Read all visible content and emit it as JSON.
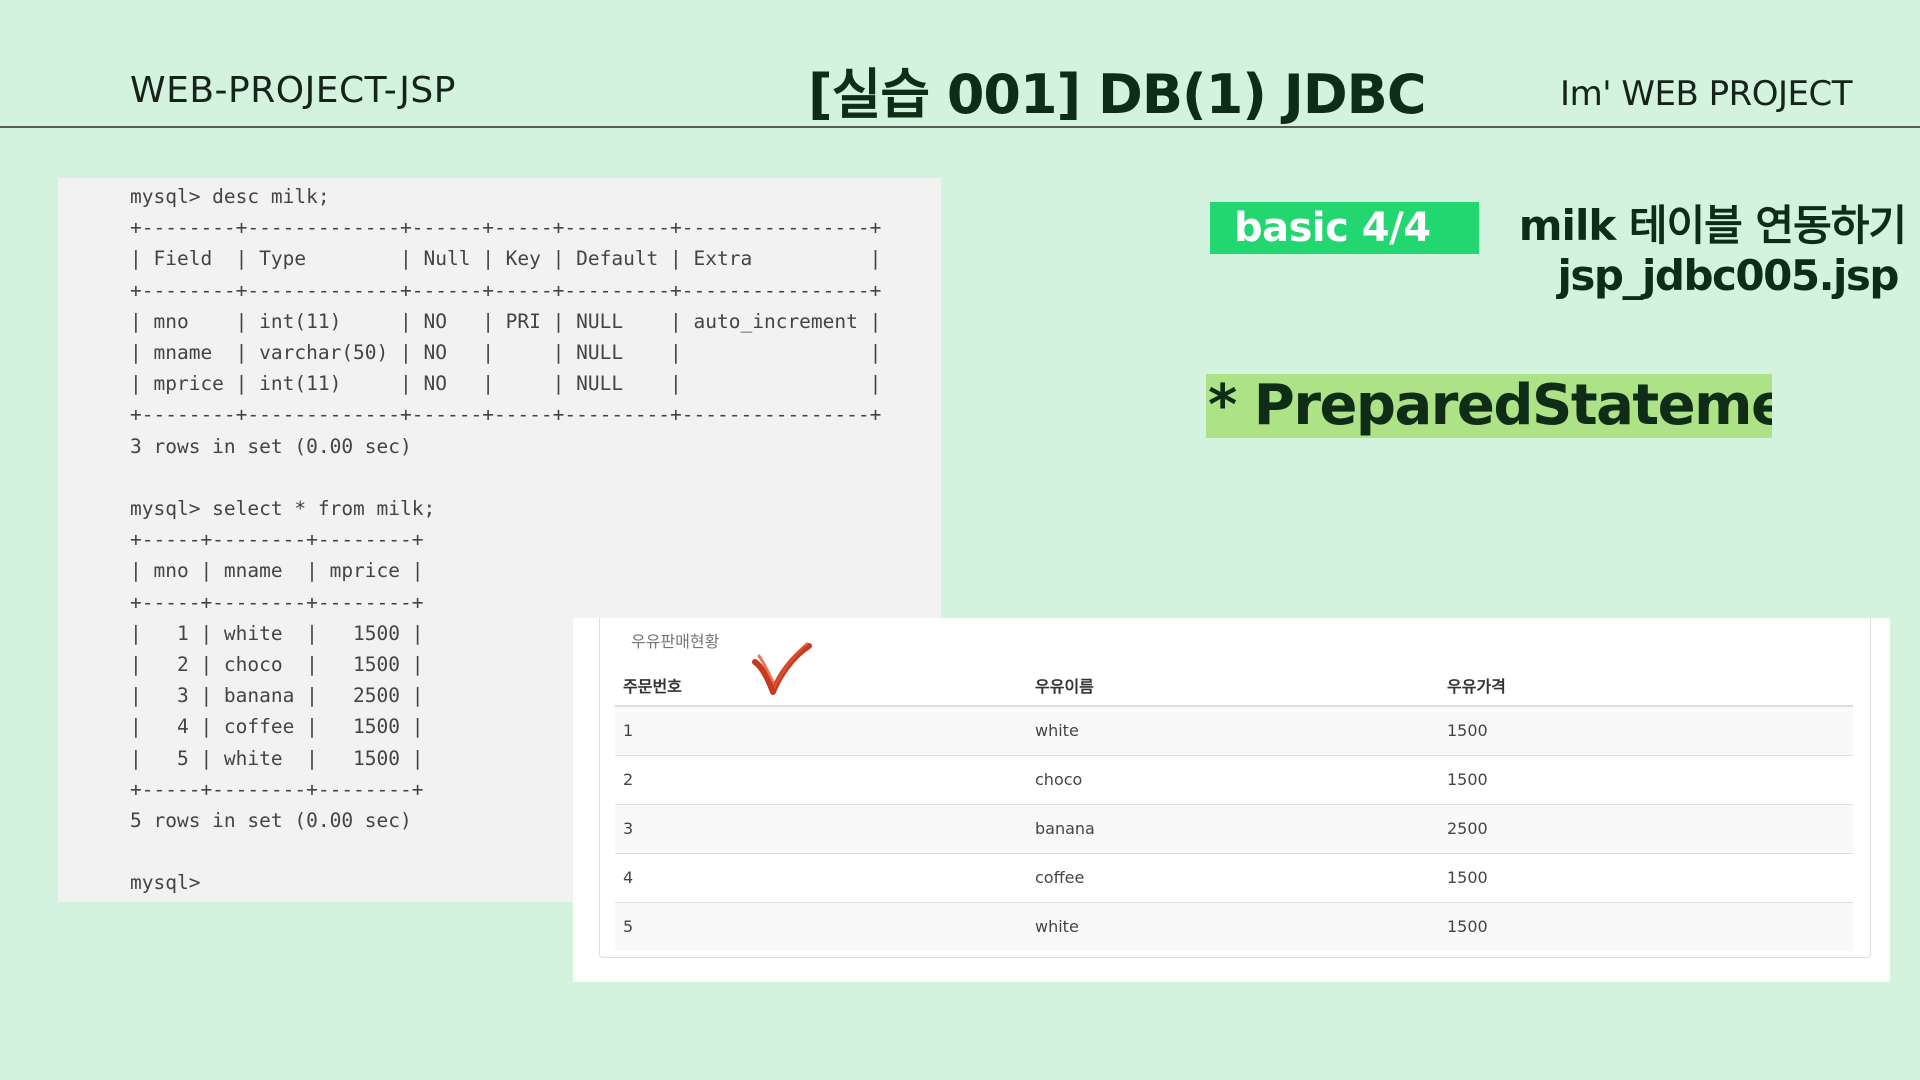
{
  "header": {
    "left": "WEB-PROJECT-JSP",
    "title": "[실습 001]  DB(1) JDBC",
    "right": "Im'  WEB PROJECT"
  },
  "console": {
    "lines": [
      "mysql> desc milk;",
      "+--------+-------------+------+-----+---------+----------------+",
      "| Field  | Type        | Null | Key | Default | Extra          |",
      "+--------+-------------+------+-----+---------+----------------+",
      "| mno    | int(11)     | NO   | PRI | NULL    | auto_increment |",
      "| mname  | varchar(50) | NO   |     | NULL    |                |",
      "| mprice | int(11)     | NO   |     | NULL    |                |",
      "+--------+-------------+------+-----+---------+----------------+",
      "3 rows in set (0.00 sec)",
      "",
      "mysql> select * from milk;",
      "+-----+--------+--------+",
      "| mno | mname  | mprice |",
      "+-----+--------+--------+",
      "|   1 | white  |   1500 |",
      "|   2 | choco  |   1500 |",
      "|   3 | banana |   2500 |",
      "|   4 | coffee |   1500 |",
      "|   5 | white  |   1500 |",
      "+-----+--------+--------+",
      "5 rows in set (0.00 sec)",
      "",
      "mysql>"
    ]
  },
  "info": {
    "badge": "basic  4/4",
    "topic": "milk 테이블 연동하기",
    "filename": "jsp_jdbc005.jsp",
    "highlight": "* PreparedStatement"
  },
  "result": {
    "caption": "우유판매현황",
    "columns": [
      "주문번호",
      "우유이름",
      "우유가격"
    ],
    "rows": [
      [
        "1",
        "white",
        "1500"
      ],
      [
        "2",
        "choco",
        "1500"
      ],
      [
        "3",
        "banana",
        "2500"
      ],
      [
        "4",
        "coffee",
        "1500"
      ],
      [
        "5",
        "white",
        "1500"
      ]
    ],
    "check_color": "#c63a1e"
  }
}
